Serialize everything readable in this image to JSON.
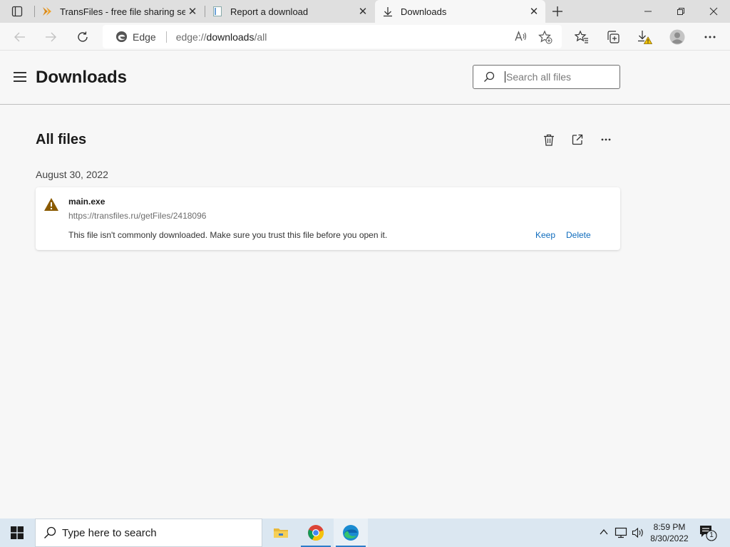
{
  "tabs": [
    {
      "title": "TransFiles - free file sharing servi",
      "active": false
    },
    {
      "title": "Report a download",
      "active": false
    },
    {
      "title": "Downloads",
      "active": true
    }
  ],
  "address_bar": {
    "site_label": "Edge",
    "url_scheme": "edge://",
    "url_host": "downloads",
    "url_path": "/all"
  },
  "page": {
    "title": "Downloads",
    "search_placeholder": "Search all files",
    "section_title": "All files"
  },
  "downloads": [
    {
      "date": "August 30, 2022",
      "filename": "main.exe",
      "url": "https://transfiles.ru/getFiles/2418096",
      "warning": "This file isn't commonly downloaded. Make sure you trust this file before you open it.",
      "keep_label": "Keep",
      "delete_label": "Delete"
    }
  ],
  "taskbar": {
    "search_placeholder": "Type here to search",
    "time": "8:59 PM",
    "date": "8/30/2022",
    "notification_count": "1"
  },
  "colors": {
    "accent": "#0f6cbd",
    "warning": "#8a5a00",
    "taskbar": "#dbe7f1"
  }
}
